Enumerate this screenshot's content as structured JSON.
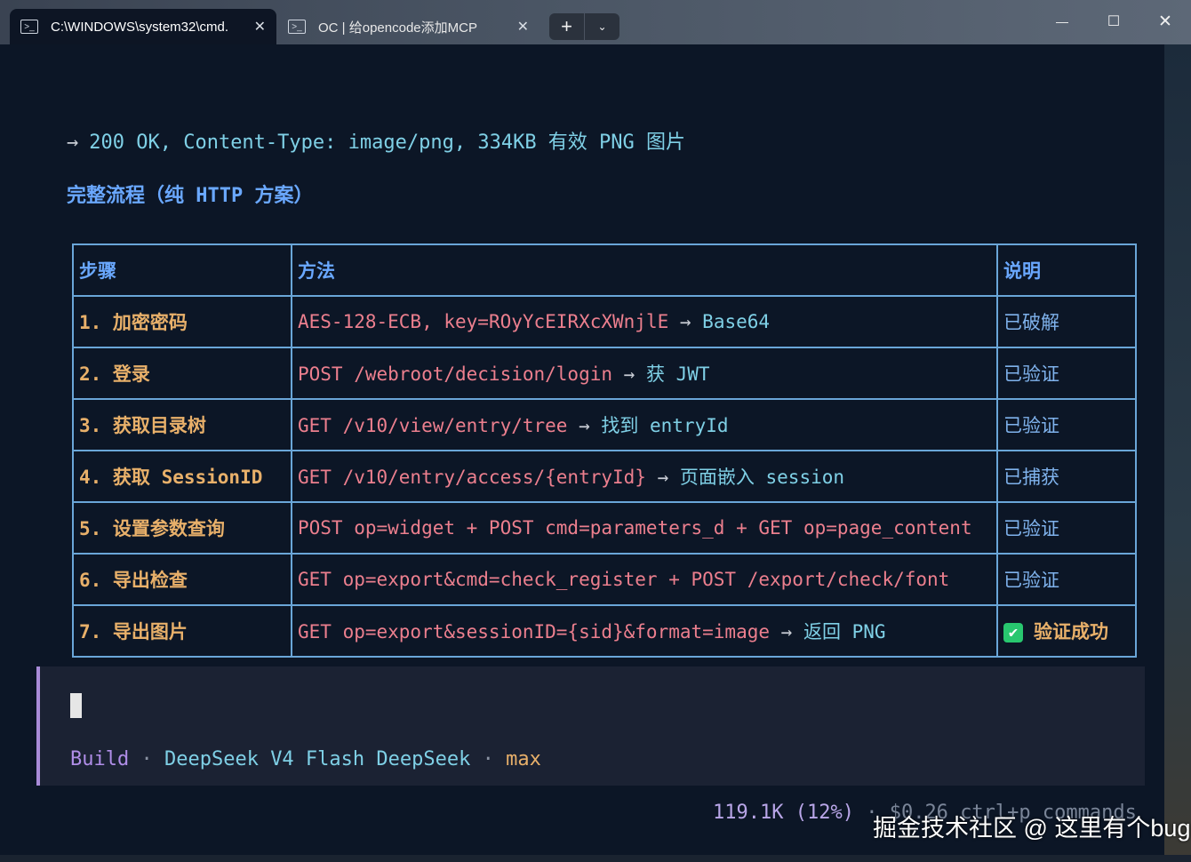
{
  "tabs": [
    {
      "title": "C:\\WINDOWS\\system32\\cmd.",
      "icon": "terminal-icon",
      "close": "✕"
    },
    {
      "title": "OC | 给opencode添加MCP",
      "icon": "terminal-icon",
      "close": "✕"
    }
  ],
  "newtab": {
    "plus": "+",
    "dropdown": "⌄"
  },
  "window_controls": {
    "minimize": "—",
    "maximize": "☐",
    "close": "✕"
  },
  "response": {
    "status_arrow": "→",
    "status_text": "200 OK, Content-Type: image/png, 334KB 有效 PNG 图片",
    "heading": "完整流程（纯 HTTP 方案）"
  },
  "table": {
    "headers": [
      "步骤",
      "方法",
      "说明"
    ],
    "rows": [
      {
        "step": "1. 加密密码",
        "method": [
          "AES-128-ECB, key=",
          "ROyYcEIRXcXWnjlE",
          " → ",
          "Base64"
        ],
        "note": "已破解"
      },
      {
        "step": "2. 登录",
        "method": [
          "POST /webroot/decision/login",
          "",
          " → ",
          "获 JWT"
        ],
        "note": "已验证"
      },
      {
        "step": "3. 获取目录树",
        "method": [
          "GET /v10/view/entry/tree",
          "",
          " → ",
          "找到 entryId"
        ],
        "note": "已验证"
      },
      {
        "step": "4. 获取 SessionID",
        "method": [
          "GET /v10/entry/access/{entryId}",
          "",
          " → ",
          "页面嵌入 session"
        ],
        "note": "已捕获"
      },
      {
        "step": "5. 设置参数查询",
        "method": [
          "POST op=widget + POST cmd=parameters_d + GET op=page_content",
          "",
          "",
          ""
        ],
        "note": "已验证"
      },
      {
        "step": "6. 导出检查",
        "method": [
          "GET op=export&cmd=check_register + POST /export/check/font",
          "",
          "",
          ""
        ],
        "note": "已验证"
      },
      {
        "step": "7. 导出图片",
        "method": [
          "GET op=export&sessionID={sid}&format=image",
          "",
          " → ",
          "返回 PNG"
        ],
        "note": "验证成功",
        "check": "✔"
      }
    ]
  },
  "prompt": {
    "mode": "Build",
    "sep": " · ",
    "model": "DeepSeek V4 Flash DeepSeek",
    "effort": "max"
  },
  "footer": {
    "tokens": "119.1K (12%)",
    "sep": " · ",
    "cost": "$0.26",
    "hint": "ctrl+p commands"
  },
  "watermark": "掘金技术社区 @ 这里有个bug"
}
